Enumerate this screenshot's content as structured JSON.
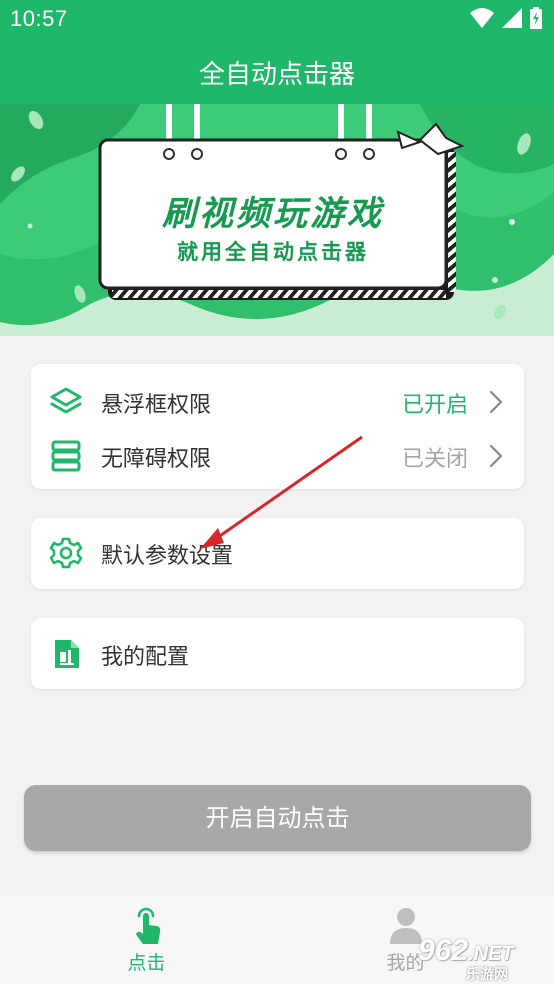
{
  "status_bar": {
    "time": "10:57",
    "icons": [
      "wifi-icon",
      "signal-icon",
      "battery-icon"
    ]
  },
  "app_bar": {
    "title": "全自动点击器"
  },
  "banner": {
    "headline": "刷视频玩游戏",
    "subline": "就用全自动点击器"
  },
  "permissions": [
    {
      "label": "悬浮框权限",
      "status": "已开启",
      "icon": "layers-icon",
      "status_color": "#1fb86a"
    },
    {
      "label": "无障碍权限",
      "status": "已关闭",
      "icon": "stack-icon",
      "status_color": "#a6a6a6"
    }
  ],
  "settings": {
    "label": "默认参数设置",
    "icon": "gear-icon"
  },
  "my_config": {
    "label": "我的配置",
    "icon": "document-icon"
  },
  "start_button": {
    "label": "开启自动点击"
  },
  "bottom_nav": [
    {
      "label": "点击",
      "icon": "tap-icon",
      "active": true
    },
    {
      "label": "我的",
      "icon": "person-icon",
      "active": false
    }
  ],
  "watermark": {
    "brand": "962",
    "tld": ".NET",
    "sub": "乐游网"
  },
  "colors": {
    "primary": "#1fb86a",
    "disabled_button": "#a8a8a8",
    "arrow": "#d62828"
  }
}
